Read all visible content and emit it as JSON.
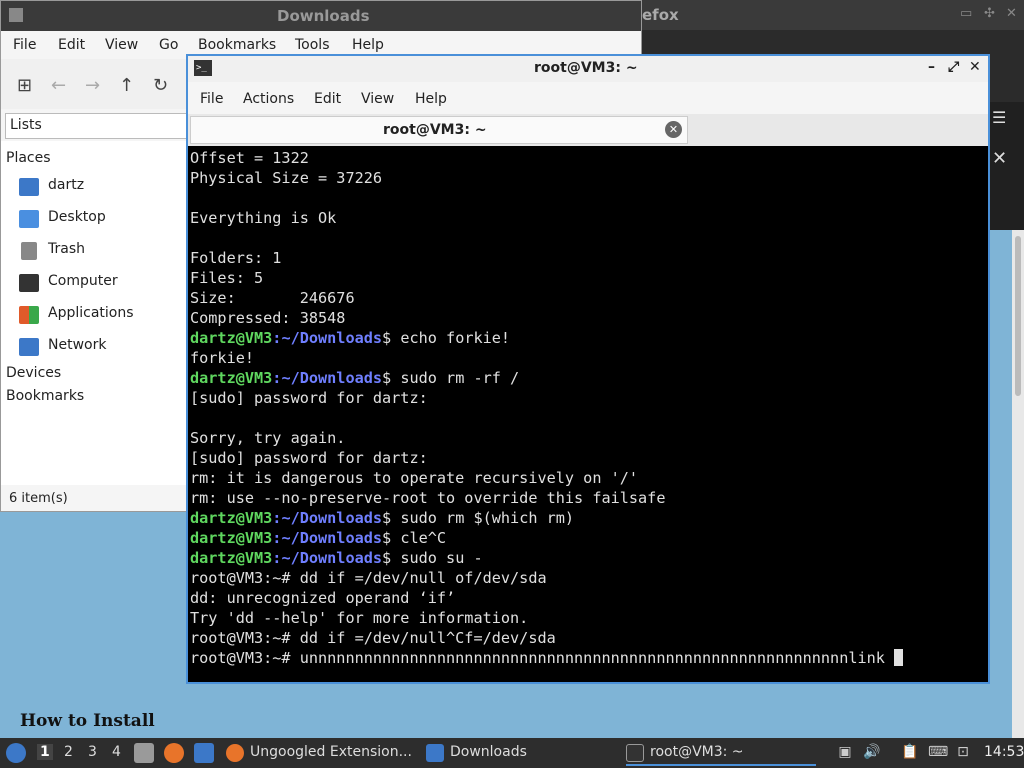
{
  "firefox_window": {
    "title_fragment": "efox",
    "menu_icon": "hamburger-icon",
    "close_icon": "close-icon"
  },
  "file_manager": {
    "title": "Downloads",
    "menus": [
      "File",
      "Edit",
      "View",
      "Go",
      "Bookmarks",
      "Tools",
      "Help"
    ],
    "lists_label": "Lists",
    "sidebar": {
      "places_heading": "Places",
      "items": [
        {
          "label": "dartz",
          "icon": "home-folder-icon",
          "color": "#3c78c8"
        },
        {
          "label": "Desktop",
          "icon": "desktop-icon",
          "color": "#4a8fe0"
        },
        {
          "label": "Trash",
          "icon": "trash-icon",
          "color": "#888888"
        },
        {
          "label": "Computer",
          "icon": "computer-icon",
          "color": "#333333"
        },
        {
          "label": "Applications",
          "icon": "applications-icon",
          "color": "#e05a2a"
        },
        {
          "label": "Network",
          "icon": "network-icon",
          "color": "#3c78c8"
        }
      ],
      "devices_heading": "Devices",
      "bookmarks_heading": "Bookmarks"
    },
    "status": "6 item(s)"
  },
  "terminal": {
    "title": "root@VM3: ~",
    "menus": [
      "File",
      "Actions",
      "Edit",
      "View",
      "Help"
    ],
    "tab_label": "root@VM3: ~",
    "prompt_user": "dartz@VM3",
    "prompt_path": ":~/Downloads",
    "prompt_symbol": "$",
    "lines": [
      {
        "type": "out",
        "text": "Offset = 1322"
      },
      {
        "type": "out",
        "text": "Physical Size = 37226"
      },
      {
        "type": "out",
        "text": ""
      },
      {
        "type": "out",
        "text": "Everything is Ok"
      },
      {
        "type": "out",
        "text": ""
      },
      {
        "type": "out",
        "text": "Folders: 1"
      },
      {
        "type": "out",
        "text": "Files: 5"
      },
      {
        "type": "out",
        "text": "Size:       246676"
      },
      {
        "type": "out",
        "text": "Compressed: 38548"
      },
      {
        "type": "cmd",
        "text": " echo forkie!"
      },
      {
        "type": "out",
        "text": "forkie!"
      },
      {
        "type": "cmd",
        "text": " sudo rm -rf /"
      },
      {
        "type": "out",
        "text": "[sudo] password for dartz:"
      },
      {
        "type": "out",
        "text": ""
      },
      {
        "type": "out",
        "text": "Sorry, try again."
      },
      {
        "type": "out",
        "text": "[sudo] password for dartz:"
      },
      {
        "type": "out",
        "text": "rm: it is dangerous to operate recursively on '/'"
      },
      {
        "type": "out",
        "text": "rm: use --no-preserve-root to override this failsafe"
      },
      {
        "type": "cmd",
        "text": " sudo rm $(which rm)"
      },
      {
        "type": "cmd",
        "text": " cle^C"
      },
      {
        "type": "cmd",
        "text": " sudo su -"
      },
      {
        "type": "out",
        "text": "root@VM3:~# dd if =/dev/null of/dev/sda"
      },
      {
        "type": "out",
        "text": "dd: unrecognized operand ‘if’"
      },
      {
        "type": "out",
        "text": "Try 'dd --help' for more information."
      },
      {
        "type": "out",
        "text": "root@VM3:~# dd if =/dev/null^Cf=/dev/sda"
      },
      {
        "type": "last",
        "text": "root@VM3:~# unnnnnnnnnnnnnnnnnnnnnnnnnnnnnnnnnnnnnnnnnnnnnnnnnnnnnnnnnnnlink "
      }
    ]
  },
  "web_page": {
    "heading": "How to Install"
  },
  "taskbar": {
    "workspaces": [
      "1",
      "2",
      "3",
      "4"
    ],
    "tasks": [
      {
        "label": "Ungoogled Extension...",
        "icon": "firefox-icon"
      },
      {
        "label": "Downloads",
        "icon": "folder-icon"
      },
      {
        "label": "root@VM3: ~",
        "icon": "terminal-icon"
      }
    ],
    "clock": "14:53"
  }
}
